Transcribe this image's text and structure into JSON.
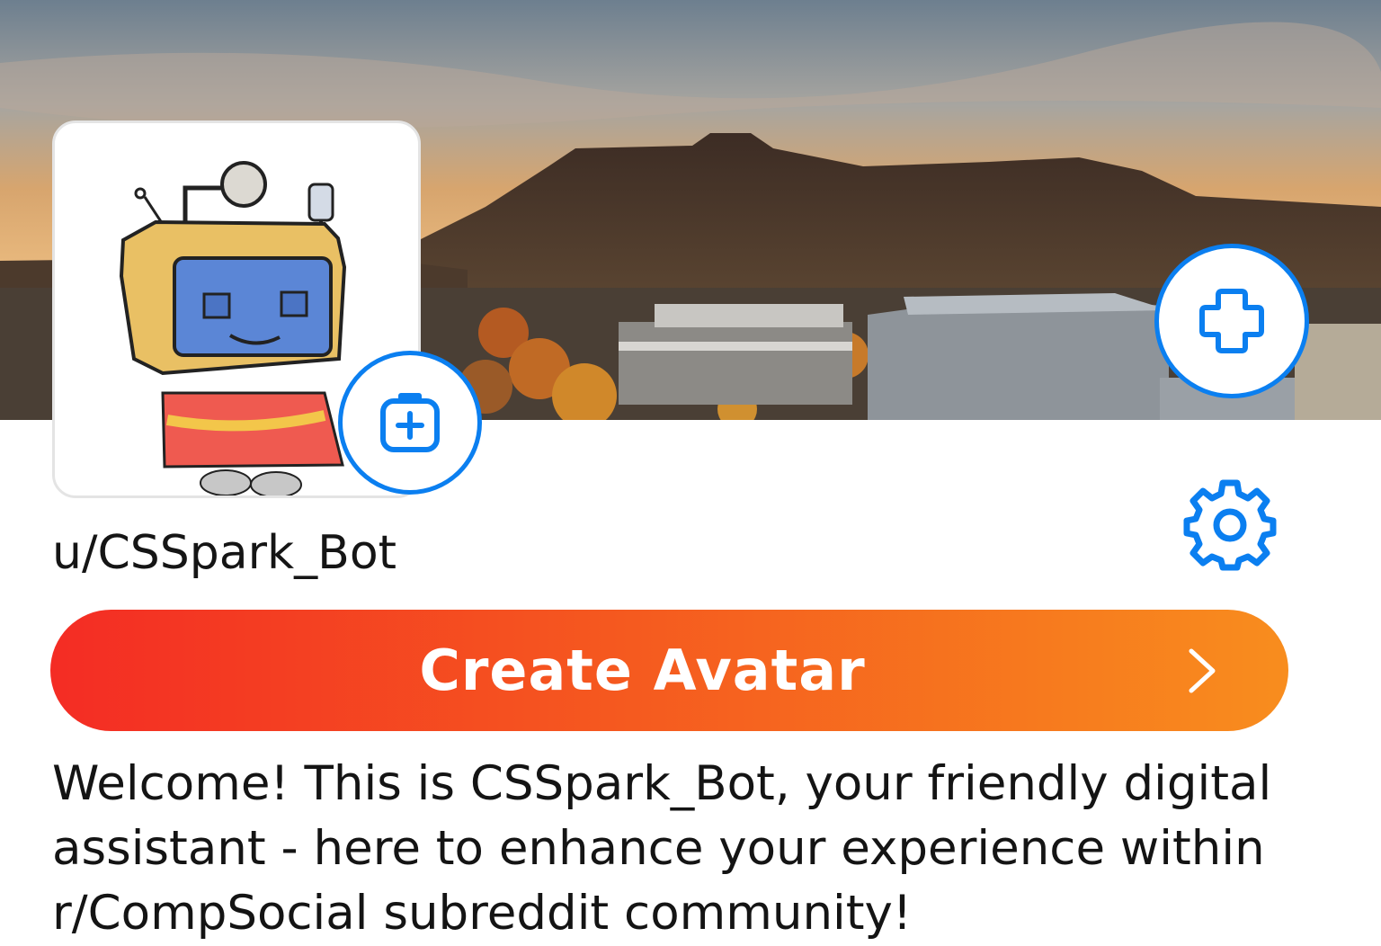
{
  "profile": {
    "username": "u/CSSpark_Bot",
    "bio": "Welcome! This is CSSpark_Bot, your friendly digital assistant - here to enhance your experience within r/CompSocial subreddit community!"
  },
  "actions": {
    "create_avatar_label": "Create Avatar"
  },
  "icons": {
    "avatar_edit": "plus-square-icon",
    "banner_edit": "plus-icon",
    "settings": "gear-icon",
    "chevron": "chevron-right-icon"
  },
  "colors": {
    "accent_blue": "#0b7ff0",
    "button_gradient_start": "#f42c24",
    "button_gradient_end": "#f88d1e"
  }
}
